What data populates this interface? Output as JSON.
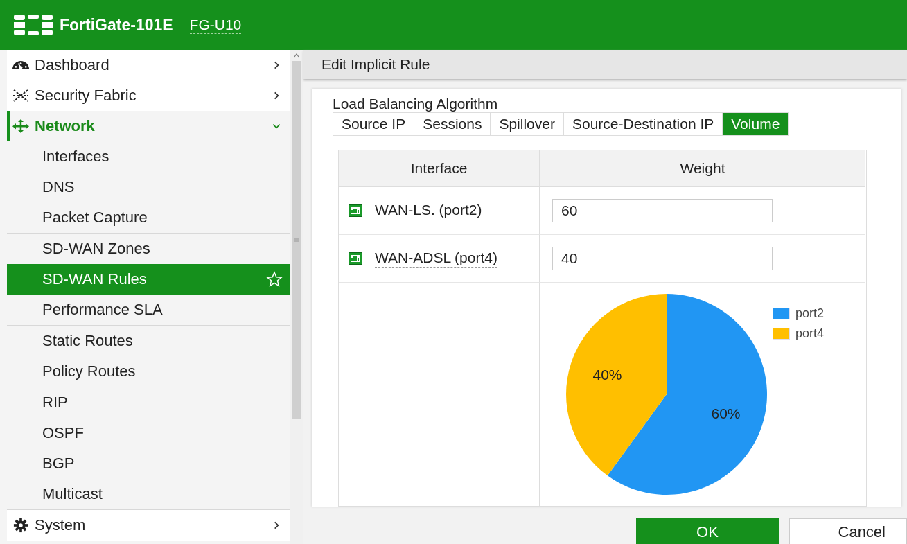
{
  "header": {
    "product": "FortiGate-101E",
    "hostname": "FG-U10"
  },
  "sidebar": {
    "items": [
      {
        "label": "Dashboard",
        "expanded": false,
        "selected": false
      },
      {
        "label": "Security Fabric",
        "expanded": false,
        "selected": false
      },
      {
        "label": "Network",
        "expanded": true,
        "selected": true,
        "groups": [
          {
            "children": [
              {
                "label": "Interfaces",
                "selected": false
              },
              {
                "label": "DNS",
                "selected": false
              },
              {
                "label": "Packet Capture",
                "selected": false
              }
            ]
          },
          {
            "children": [
              {
                "label": "SD-WAN Zones",
                "selected": false
              },
              {
                "label": "SD-WAN Rules",
                "selected": true
              },
              {
                "label": "Performance SLA",
                "selected": false
              }
            ]
          },
          {
            "children": [
              {
                "label": "Static Routes",
                "selected": false
              },
              {
                "label": "Policy Routes",
                "selected": false
              }
            ]
          },
          {
            "children": [
              {
                "label": "RIP",
                "selected": false
              },
              {
                "label": "OSPF",
                "selected": false
              },
              {
                "label": "BGP",
                "selected": false
              },
              {
                "label": "Multicast",
                "selected": false
              }
            ]
          }
        ]
      },
      {
        "label": "System",
        "expanded": false,
        "selected": false
      }
    ]
  },
  "panel": {
    "title": "Edit Implicit Rule",
    "algorithm": {
      "label": "Load Balancing Algorithm",
      "tabs": [
        {
          "label": "Source IP",
          "selected": false
        },
        {
          "label": "Sessions",
          "selected": false
        },
        {
          "label": "Spillover",
          "selected": false
        },
        {
          "label": "Source-Destination IP",
          "selected": false
        },
        {
          "label": "Volume",
          "selected": true
        }
      ]
    },
    "table": {
      "columns": [
        "Interface",
        "Weight"
      ],
      "rows": [
        {
          "interface": "WAN-LS. (port2)",
          "weight": "60"
        },
        {
          "interface": "WAN-ADSL (port4)",
          "weight": "40"
        }
      ]
    },
    "chart_data": {
      "type": "pie",
      "categories": [
        "port2",
        "port4"
      ],
      "colors": [
        "#2196f3",
        "#ffbf00"
      ],
      "values": [
        60,
        40
      ],
      "value_labels": [
        "60%",
        "40%"
      ]
    },
    "buttons": [
      {
        "label": "OK",
        "kind": "primary"
      },
      {
        "label": "Cancel",
        "kind": "secondary"
      }
    ]
  }
}
